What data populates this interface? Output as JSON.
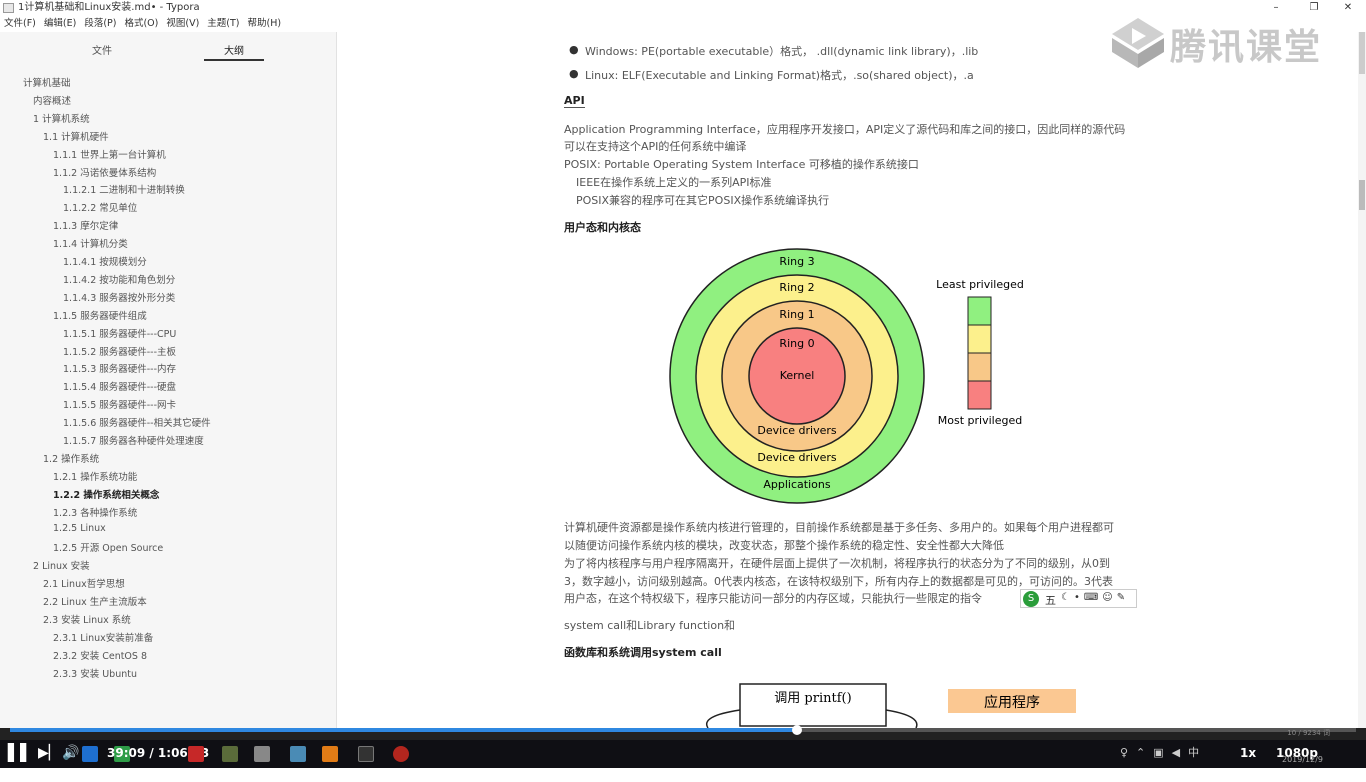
{
  "window": {
    "title": "1计算机基础和Linux安装.md• - Typora",
    "min": "–",
    "max": "❐",
    "close": "✕"
  },
  "menu": [
    "文件(F)",
    "编辑(E)",
    "段落(P)",
    "格式(O)",
    "视图(V)",
    "主题(T)",
    "帮助(H)"
  ],
  "sidebar": {
    "tabs": [
      "文件",
      "大纲"
    ],
    "outline": [
      {
        "t": "计算机基础",
        "l": 0
      },
      {
        "t": "内容概述",
        "l": 1
      },
      {
        "t": "1 计算机系统",
        "l": 1
      },
      {
        "t": "1.1 计算机硬件",
        "l": 2
      },
      {
        "t": "1.1.1 世界上第一台计算机",
        "l": 3
      },
      {
        "t": "1.1.2 冯诺依曼体系结构",
        "l": 3
      },
      {
        "t": "1.1.2.1 二进制和十进制转换",
        "l": 4
      },
      {
        "t": "1.1.2.2 常见单位",
        "l": 4
      },
      {
        "t": "1.1.3 摩尔定律",
        "l": 3
      },
      {
        "t": "1.1.4 计算机分类",
        "l": 3
      },
      {
        "t": "1.1.4.1 按规模划分",
        "l": 4
      },
      {
        "t": "1.1.4.2 按功能和角色划分",
        "l": 4
      },
      {
        "t": "1.1.4.3 服务器按外形分类",
        "l": 4
      },
      {
        "t": "1.1.5 服务器硬件组成",
        "l": 3
      },
      {
        "t": "1.1.5.1 服务器硬件---CPU",
        "l": 4
      },
      {
        "t": "1.1.5.2 服务器硬件---主板",
        "l": 4
      },
      {
        "t": "1.1.5.3 服务器硬件---内存",
        "l": 4
      },
      {
        "t": "1.1.5.4 服务器硬件---硬盘",
        "l": 4
      },
      {
        "t": "1.1.5.5 服务器硬件---网卡",
        "l": 4
      },
      {
        "t": "1.1.5.6 服务器硬件--相关其它硬件",
        "l": 4
      },
      {
        "t": "1.1.5.7 服务器各种硬件处理速度",
        "l": 4
      },
      {
        "t": "1.2 操作系统",
        "l": 2
      },
      {
        "t": "1.2.1 操作系统功能",
        "l": 3
      },
      {
        "t": "1.2.2 操作系统相关概念",
        "l": 3,
        "active": true
      },
      {
        "t": "1.2.3 各种操作系统",
        "l": 3
      },
      {
        "t": "1.2.5 Linux",
        "l": 3
      },
      {
        "t": "1.2.5 开源 Open Source",
        "l": 3
      },
      {
        "t": "2 Linux 安装",
        "l": 1
      },
      {
        "t": "2.1 Linux哲学思想",
        "l": 2
      },
      {
        "t": "2.2 Linux 生产主流版本",
        "l": 2
      },
      {
        "t": "2.3 安装 Linux 系统",
        "l": 2
      },
      {
        "t": "2.3.1 Linux安装前准备",
        "l": 3
      },
      {
        "t": "2.3.2 安装 CentOS 8",
        "l": 3
      },
      {
        "t": "2.3.3 安装 Ubuntu",
        "l": 3
      }
    ]
  },
  "content": {
    "b1": "Windows: PE(portable executable）格式， .dll(dynamic link library)，.lib",
    "b2": "Linux: ELF(Executable and Linking Format)格式，.so(shared object)，.a",
    "api_h": "API",
    "p1": "Application Programming Interface，应用程序开发接口，API定义了源代码和库之间的接口，因此同样的源代码",
    "p2": "可以在支持这个API的任何系统中编译",
    "p3": "POSIX: Portable Operating System Interface 可移植的操作系统接口",
    "p4": "IEEE在操作系统上定义的一系列API标准",
    "p5": "POSIX兼容的程序可在其它POSIX操作系统编译执行",
    "h2": "用户态和内核态",
    "q1": "计算机硬件资源都是操作系统内核进行管理的，目前操作系统都是基于多任务、多用户的。如果每个用户进程都可",
    "q2": "以随便访问操作系统内核的模块，改变状态，那整个操作系统的稳定性、安全性都大大降低",
    "q3": "为了将内核程序与用户程序隔离开，在硬件层面上提供了一次机制，将程序执行的状态分为了不同的级别，从0到",
    "q4": "3，数字越小，访问级别越高。0代表内核态，在该特权级别下，所有内存上的数据都是可见的，可访问的。3代表",
    "q5": "用户态，在这个特权级下，程序只能访问一部分的内存区域，只能执行一些限定的指令",
    "q6": "system call和Library function和",
    "h3": "函数库和系统调用system call"
  },
  "rings": {
    "r3": "Ring 3",
    "r2": "Ring 2",
    "r1": "Ring 1",
    "r0": "Ring 0",
    "kernel": "Kernel",
    "dd1": "Device drivers",
    "dd2": "Device drivers",
    "apps": "Applications",
    "least": "Least privileged",
    "most": "Most privileged",
    "colors": {
      "r3": "#90f080",
      "r2": "#fcf08c",
      "r1": "#f8c888",
      "r0": "#f88080"
    }
  },
  "diagram2": {
    "call": "调用 printf()",
    "app": "应用程序"
  },
  "logo": {
    "text": "腾讯课堂"
  },
  "ime": {
    "label": "五"
  },
  "player": {
    "time": "39:09 / 1:06:53",
    "speed": "1x",
    "quality": "1080p",
    "wordcount": "10 / 9234 词",
    "date": "2019/12/9",
    "progress": 0.585
  }
}
